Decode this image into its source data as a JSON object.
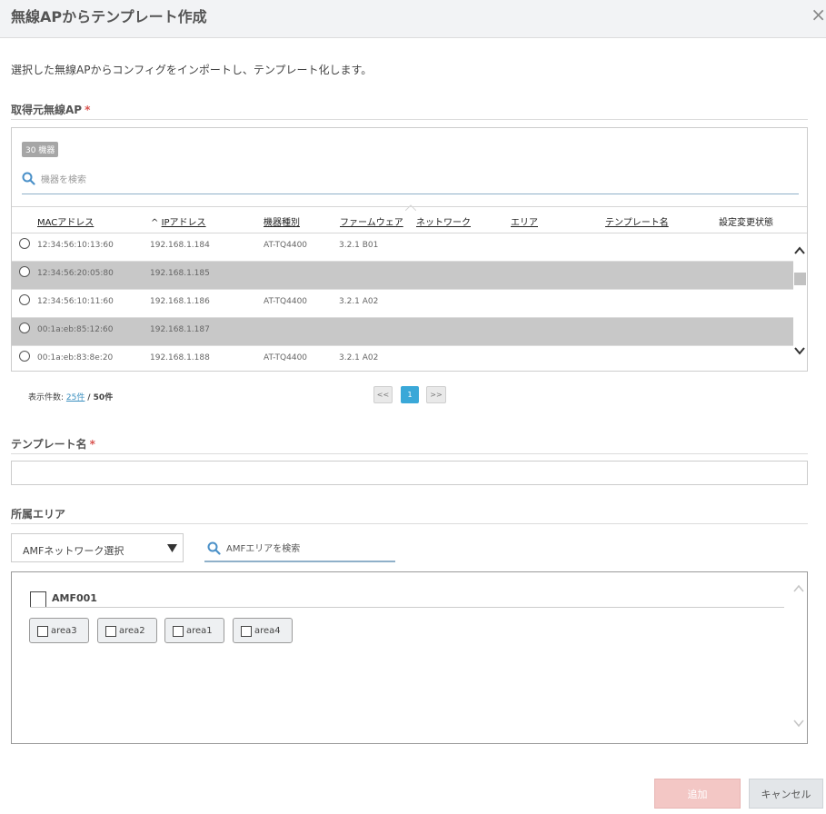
{
  "header": {
    "title": "無線APからテンプレート作成",
    "close_label": "×"
  },
  "description": "選択した無線APからコンフィグをインポートし、テンプレート化します。",
  "source_ap": {
    "label": "取得元無線AP",
    "required_mark": "*",
    "badge": "30 機器",
    "search_placeholder": "機器を検索",
    "sort_indicator": "^",
    "columns": [
      "MACアドレス",
      "IPアドレス",
      "機器種別",
      "ファームウェア",
      "ネットワーク",
      "エリア",
      "テンプレート名",
      "設定変更状態"
    ],
    "rows": [
      {
        "mac": "12:34:56:10:13:60",
        "ip": "192.168.1.184",
        "model": "AT-TQ4400",
        "firmware": "3.2.1 B01",
        "disabled": false
      },
      {
        "mac": "12:34:56:20:05:80",
        "ip": "192.168.1.185",
        "model": "",
        "firmware": "",
        "disabled": true
      },
      {
        "mac": "12:34:56:10:11:60",
        "ip": "192.168.1.186",
        "model": "AT-TQ4400",
        "firmware": "3.2.1 A02",
        "disabled": false
      },
      {
        "mac": "00:1a:eb:85:12:60",
        "ip": "192.168.1.187",
        "model": "",
        "firmware": "",
        "disabled": true
      },
      {
        "mac": "00:1a:eb:83:8e:20",
        "ip": "192.168.1.188",
        "model": "AT-TQ4400",
        "firmware": "3.2.1 A02",
        "disabled": false
      }
    ],
    "pagination": {
      "label": "表示件数:",
      "per_page": "25件",
      "total": "/ 50件",
      "prev": "<<",
      "current": "1",
      "next": ">>"
    }
  },
  "template_name": {
    "label": "テンプレート名",
    "required_mark": "*",
    "value": ""
  },
  "area": {
    "label": "所属エリア",
    "network_select": "AMFネットワーク選択",
    "search_placeholder": "AMFエリアを検索",
    "group": {
      "name": "AMF001",
      "areas": [
        "area3",
        "area2",
        "area1",
        "area4"
      ]
    }
  },
  "footer": {
    "add_label": "追加",
    "cancel_label": "キャンセル"
  },
  "colors": {
    "disabled_row": "#c8c8c8",
    "active_page": "#3aa8d8",
    "add_button": "#f3c7c5",
    "required": "#d9534f"
  },
  "icons": [
    "close-icon",
    "search-icon",
    "radio-icon",
    "chevron-up-icon",
    "chevron-down-icon",
    "caret-down-icon",
    "checkbox-icon"
  ]
}
